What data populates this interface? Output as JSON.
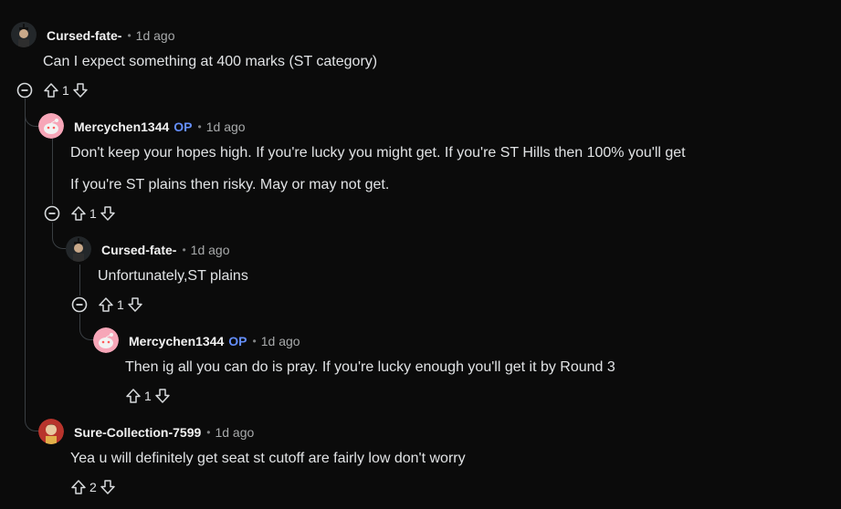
{
  "comments": [
    {
      "username": "Cursed-fate-",
      "op": "",
      "separator": "•",
      "time": "1d ago",
      "paragraphs": [
        "Can I expect something at 400 marks (ST category)"
      ],
      "score": "1"
    },
    {
      "username": "Mercychen1344",
      "op": "OP",
      "separator": "•",
      "time": "1d ago",
      "paragraphs": [
        "Don't keep your hopes high. If you're lucky you might get. If you're ST Hills then 100% you'll get",
        "If you're ST plains then risky. May or may not get."
      ],
      "score": "1"
    },
    {
      "username": "Cursed-fate-",
      "op": "",
      "separator": "•",
      "time": "1d ago",
      "paragraphs": [
        "Unfortunately,ST plains"
      ],
      "score": "1"
    },
    {
      "username": "Mercychen1344",
      "op": "OP",
      "separator": "•",
      "time": "1d ago",
      "paragraphs": [
        "Then ig all you can do is pray. If you're lucky enough you'll get it by Round 3"
      ],
      "score": "1"
    },
    {
      "username": "Sure-Collection-7599",
      "op": "",
      "separator": "•",
      "time": "1d ago",
      "paragraphs": [
        "Yea u will definitely get seat st cutoff are fairly low don't worry"
      ],
      "score": "2"
    }
  ],
  "icons": {
    "collapse": "collapse-minus-icon",
    "upvote": "upvote-arrow-icon",
    "downvote": "downvote-arrow-icon"
  },
  "colors": {
    "background": "#0b0b0b",
    "op": "#648efc",
    "thread_line": "#3a3f43"
  }
}
